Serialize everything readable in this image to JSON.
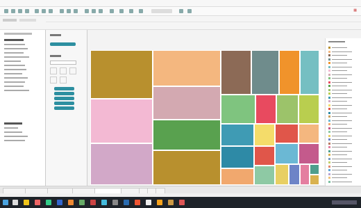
{
  "menu": [],
  "sheet_title": "",
  "legend_items": [
    {
      "color": "#b8902e"
    },
    {
      "color": "#f4b77f"
    },
    {
      "color": "#8c6a56"
    },
    {
      "color": "#6f8c8c"
    },
    {
      "color": "#f0932b"
    },
    {
      "color": "#75bfc2"
    },
    {
      "color": "#f3b9d3"
    },
    {
      "color": "#d3a9b1"
    },
    {
      "color": "#7fc47f"
    },
    {
      "color": "#e84a5f"
    },
    {
      "color": "#59a14f"
    },
    {
      "color": "#9cc36a"
    },
    {
      "color": "#b9ce4f"
    },
    {
      "color": "#3f9bb4"
    },
    {
      "color": "#d2a8c8"
    },
    {
      "color": "#f4dc6a"
    },
    {
      "color": "#e0564a"
    },
    {
      "color": "#2e8aa6"
    },
    {
      "color": "#c7a05a"
    },
    {
      "color": "#6bb8d4"
    },
    {
      "color": "#f1a86e"
    },
    {
      "color": "#c45a8c"
    },
    {
      "color": "#8ec9a4"
    },
    {
      "color": "#e8cf63"
    },
    {
      "color": "#6d84c7"
    },
    {
      "color": "#b87a62"
    },
    {
      "color": "#e47ea0"
    },
    {
      "color": "#4f9e8d"
    },
    {
      "color": "#d9b24f"
    },
    {
      "color": "#7a9ac2"
    },
    {
      "color": "#c2d06a"
    },
    {
      "color": "#e3876b"
    },
    {
      "color": "#5fa6d8"
    },
    {
      "color": "#b6a3d2"
    },
    {
      "color": "#f0c37a"
    },
    {
      "color": "#7cc1a2"
    }
  ],
  "treemap": [
    {
      "color": "#b8902e"
    },
    {
      "color": "#f3b9d3"
    },
    {
      "color": "#d2a8c8"
    },
    {
      "color": "#f4b77f"
    },
    {
      "color": "#d3a9b1"
    },
    {
      "color": "#59a14f"
    },
    {
      "color": "#b8902e"
    },
    {
      "color": "#8c6a56"
    },
    {
      "color": "#6f8c8c"
    },
    {
      "color": "#f0932b"
    },
    {
      "color": "#75bfc2"
    },
    {
      "color": "#7fc47f"
    },
    {
      "color": "#e84a5f"
    },
    {
      "color": "#9cc36a"
    },
    {
      "color": "#b9ce4f"
    },
    {
      "color": "#3f9bb4"
    },
    {
      "color": "#f4dc6a"
    },
    {
      "color": "#e0564a"
    },
    {
      "color": "#f4b77f"
    },
    {
      "color": "#2e8aa6"
    },
    {
      "color": "#e0564a"
    },
    {
      "color": "#6bb8d4"
    },
    {
      "color": "#c45a8c"
    },
    {
      "color": "#f1a86e"
    },
    {
      "color": "#8ec9a4"
    },
    {
      "color": "#e8cf63"
    },
    {
      "color": "#6d84c7"
    },
    {
      "color": "#e47ea0"
    },
    {
      "color": "#4f9e8d"
    },
    {
      "color": "#d9b24f"
    }
  ]
}
